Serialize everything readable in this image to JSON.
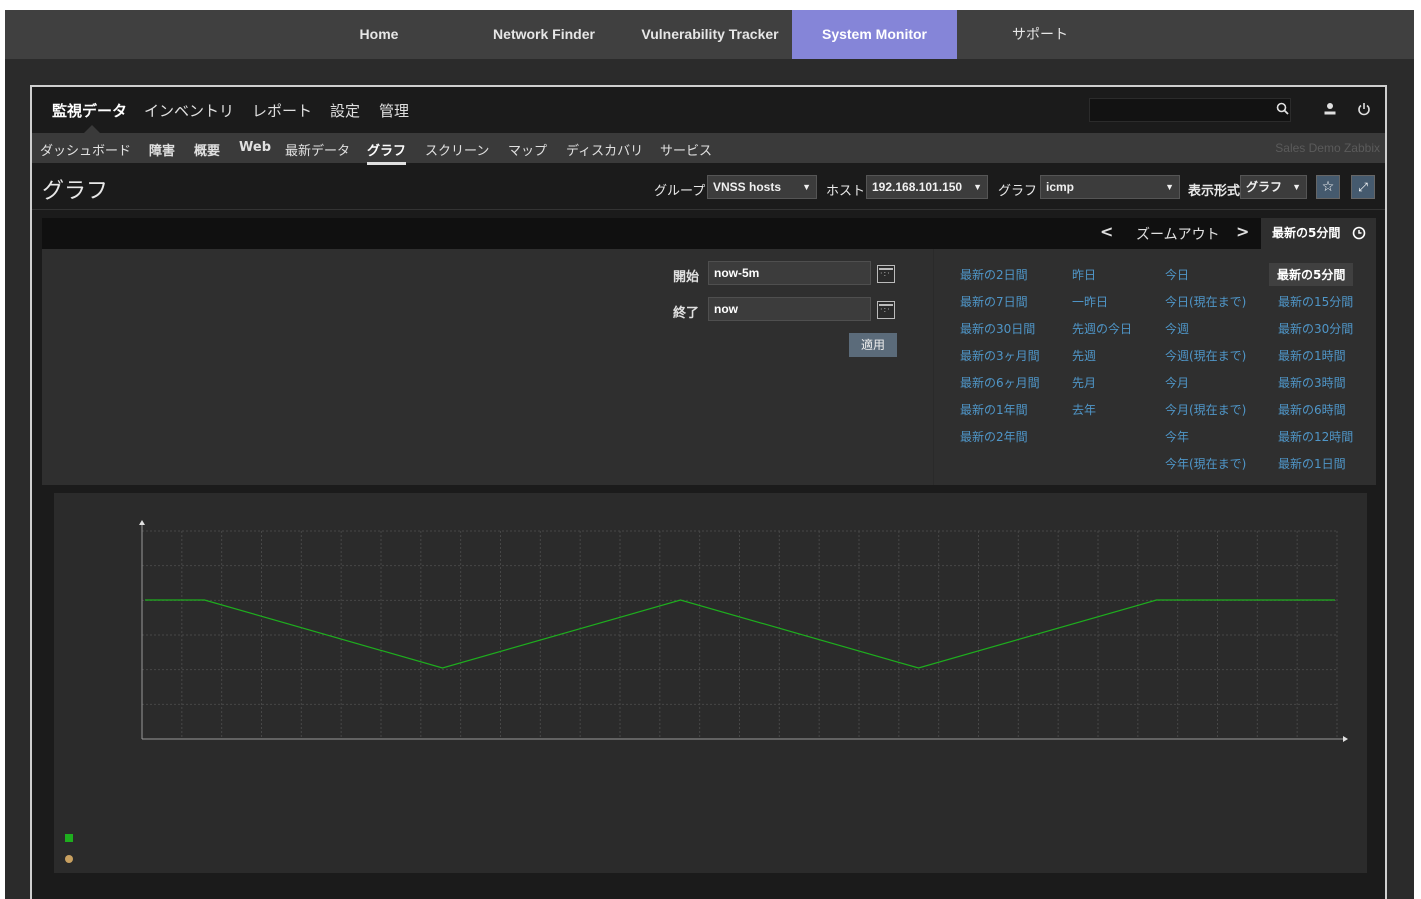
{
  "topnav": {
    "tabs": [
      {
        "label": "Home"
      },
      {
        "label": "Network Finder"
      },
      {
        "label": "Vulnerability Tracker"
      },
      {
        "label": "System Monitor"
      },
      {
        "label": "サポート"
      }
    ],
    "active": "System Monitor",
    "active_color": "#8585d8"
  },
  "main_menu": {
    "items": [
      "監視データ",
      "インベントリ",
      "レポート",
      "設定",
      "管理"
    ],
    "selected": "監視データ"
  },
  "search": {
    "placeholder": "",
    "icon": "search-icon"
  },
  "header_icons": [
    "user-icon",
    "power-icon"
  ],
  "sub_menu": {
    "items": [
      "ダッシュボード",
      "障害",
      "概要",
      "Web",
      "最新データ",
      "グラフ",
      "スクリーン",
      "マップ",
      "ディスカバリ",
      "サービス"
    ],
    "current": "グラフ",
    "server_name": "Sales Demo Zabbix"
  },
  "page": {
    "title": "グラフ",
    "filters": {
      "group_label": "グループ",
      "group_value": "VNSS hosts",
      "host_label": "ホスト",
      "host_value": "192.168.101.150",
      "graph_label": "グラフ",
      "graph_value": "icmp",
      "view_label": "表示形式",
      "view_value": "グラフ"
    },
    "icons": [
      "star-icon",
      "fullscreen-icon"
    ]
  },
  "timebar": {
    "prev": "<",
    "zoom_out": "ズームアウト",
    "next": ">",
    "tab_label": "最新の5分間",
    "tab_icon": "clock-icon"
  },
  "time_filter": {
    "from_label": "開始",
    "from_value": "now-5m",
    "to_label": "終了",
    "to_value": "now",
    "apply": "適用",
    "quick_ranges": [
      [
        "最新の2日間",
        "最新の7日間",
        "最新の30日間",
        "最新の3ヶ月間",
        "最新の6ヶ月間",
        "最新の1年間",
        "最新の2年間"
      ],
      [
        "昨日",
        "一昨日",
        "先週の今日",
        "先週",
        "先月",
        "去年"
      ],
      [
        "今日",
        "今日(現在まで)",
        "今週",
        "今週(現在まで)",
        "今月",
        "今月(現在まで)",
        "今年",
        "今年(現在まで)"
      ],
      [
        "最新の5分間",
        "最新の15分間",
        "最新の30分間",
        "最新の1時間",
        "最新の3時間",
        "最新の6時間",
        "最新の12時間",
        "最新の1日間"
      ]
    ],
    "selected": "最新の5分間",
    "link_color": "#4f96c8"
  },
  "chart_data": {
    "type": "line",
    "series": [
      {
        "color": "#1eae1e",
        "values": [
          2.0,
          2.0,
          0.0,
          2.0,
          0.0,
          2.0,
          2.0
        ]
      }
    ],
    "legend": [
      "legend-green-square",
      "legend-tan-dot"
    ],
    "grid": true
  }
}
